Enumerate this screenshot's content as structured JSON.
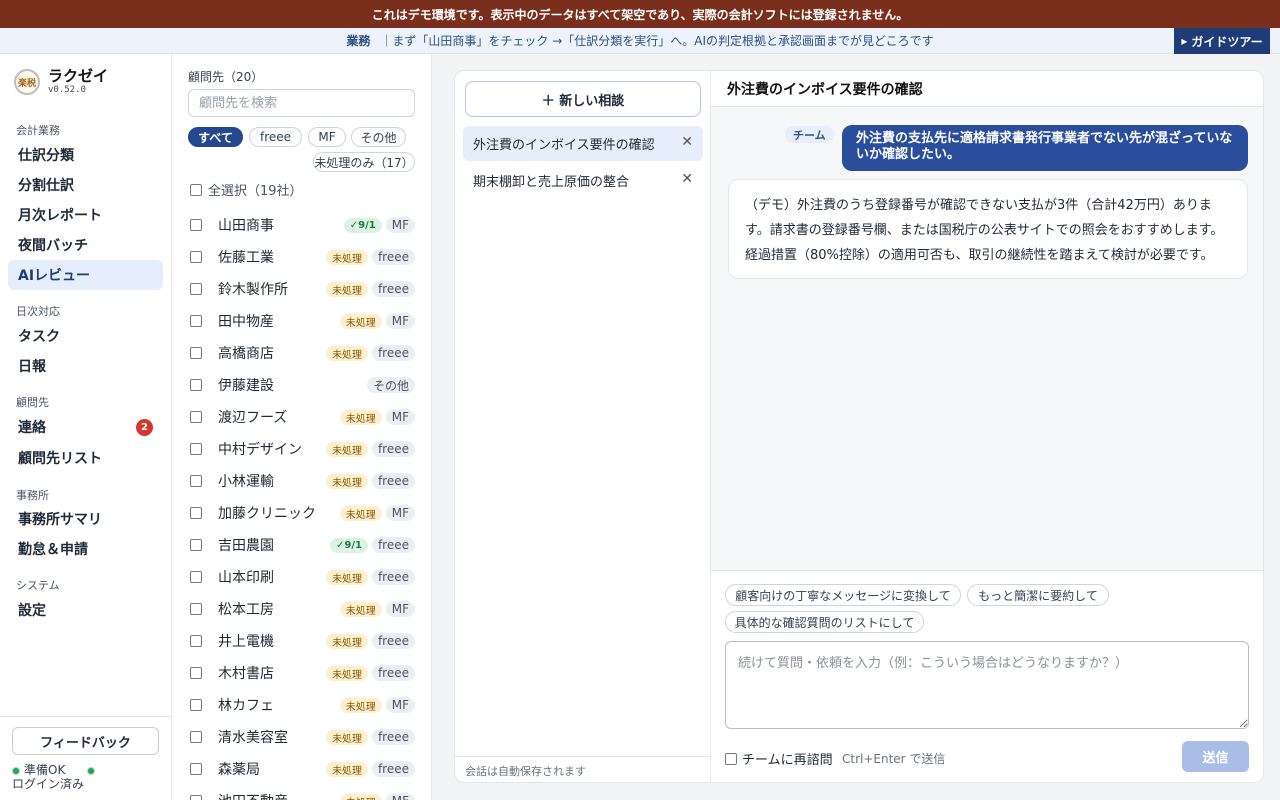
{
  "banner": "これはデモ環境です。表示中のデータはすべて架空であり、実際の会計ソフトには登録されません。",
  "guide": {
    "tag": "業務",
    "text": "｜まず「山田商事」をチェック →「仕訳分類を実行」へ。AIの判定根拠と承認画面までが見どころです",
    "button": "ガイドツアー"
  },
  "brand": {
    "logo_text": "楽税",
    "name": "ラクゼイ",
    "version": "v0.52.0"
  },
  "nav": {
    "sections": [
      {
        "label": "会計業務"
      },
      {
        "label": "日次対応"
      },
      {
        "label": "顧問先"
      },
      {
        "label": "事務所"
      },
      {
        "label": "システム"
      }
    ],
    "items": [
      {
        "label": "仕訳分類"
      },
      {
        "label": "分割仕訳"
      },
      {
        "label": "月次レポート"
      },
      {
        "label": "夜間バッチ"
      },
      {
        "label": "AIレビュー"
      },
      {
        "label": "タスク"
      },
      {
        "label": "日報"
      },
      {
        "label": "連絡",
        "badge": "2"
      },
      {
        "label": "顧問先リスト"
      },
      {
        "label": "事務所サマリ"
      },
      {
        "label": "勤怠＆申請"
      },
      {
        "label": "設定"
      }
    ],
    "feedback": "フィードバック",
    "status_ready": "準備OK",
    "status_login": "ログイン済み"
  },
  "clients": {
    "title": "顧問先（20）",
    "search_placeholder": "顧問先を検索",
    "filters": [
      "すべて",
      "freee",
      "MF",
      "その他"
    ],
    "pending_only": "未処理のみ（17）",
    "select_all": "全選択（19社）",
    "rows": [
      {
        "name": "山田商事",
        "status": "✓9/1",
        "soft": "MF"
      },
      {
        "name": "佐藤工業",
        "status": "未処理",
        "soft": "freee"
      },
      {
        "name": "鈴木製作所",
        "status": "未処理",
        "soft": "freee"
      },
      {
        "name": "田中物産",
        "status": "未処理",
        "soft": "MF"
      },
      {
        "name": "高橋商店",
        "status": "未処理",
        "soft": "freee"
      },
      {
        "name": "伊藤建設",
        "status": "",
        "soft": "その他"
      },
      {
        "name": "渡辺フーズ",
        "status": "未処理",
        "soft": "MF"
      },
      {
        "name": "中村デザイン",
        "status": "未処理",
        "soft": "freee"
      },
      {
        "name": "小林運輸",
        "status": "未処理",
        "soft": "freee"
      },
      {
        "name": "加藤クリニック",
        "status": "未処理",
        "soft": "MF"
      },
      {
        "name": "吉田農園",
        "status": "✓9/1",
        "soft": "freee"
      },
      {
        "name": "山本印刷",
        "status": "未処理",
        "soft": "freee"
      },
      {
        "name": "松本工房",
        "status": "未処理",
        "soft": "MF"
      },
      {
        "name": "井上電機",
        "status": "未処理",
        "soft": "freee"
      },
      {
        "name": "木村書店",
        "status": "未処理",
        "soft": "freee"
      },
      {
        "name": "林カフェ",
        "status": "未処理",
        "soft": "MF"
      },
      {
        "name": "清水美容室",
        "status": "未処理",
        "soft": "freee"
      },
      {
        "name": "森薬局",
        "status": "未処理",
        "soft": "freee"
      },
      {
        "name": "池田不動産",
        "status": "未処理",
        "soft": "MF"
      }
    ]
  },
  "threads": {
    "new_label": "＋ 新しい相談",
    "items": [
      {
        "title": "外注費のインボイス要件の確認"
      },
      {
        "title": "期末棚卸と売上原価の整合"
      }
    ],
    "footer": "会話は自動保存されます"
  },
  "chat": {
    "title": "外注費のインボイス要件の確認",
    "team_tag": "チーム",
    "user_message": "外注費の支払先に適格請求書発行事業者でない先が混ざっていないか確認したい。",
    "ai_message": "（デモ）外注費のうち登録番号が確認できない支払が3件（合計42万円）あります。請求書の登録番号欄、または国税庁の公表サイトでの照会をおすすめします。経過措置（80%控除）の適用可否も、取引の継続性を踏まえて検討が必要です。",
    "suggestions": [
      "顧客向けの丁寧なメッセージに変換して",
      "もっと簡潔に要約して",
      "具体的な確認質問のリストにして"
    ],
    "input_placeholder": "続けて質問・依頼を入力（例：こういう場合はどうなりますか？）",
    "recheck_label": "チームに再諮問",
    "shortcut_hint": "Ctrl+Enter で送信",
    "send_label": "送信"
  },
  "colors": {
    "banner": "#7a2e1c",
    "accent": "#24478f",
    "badge": "#d4382c"
  }
}
